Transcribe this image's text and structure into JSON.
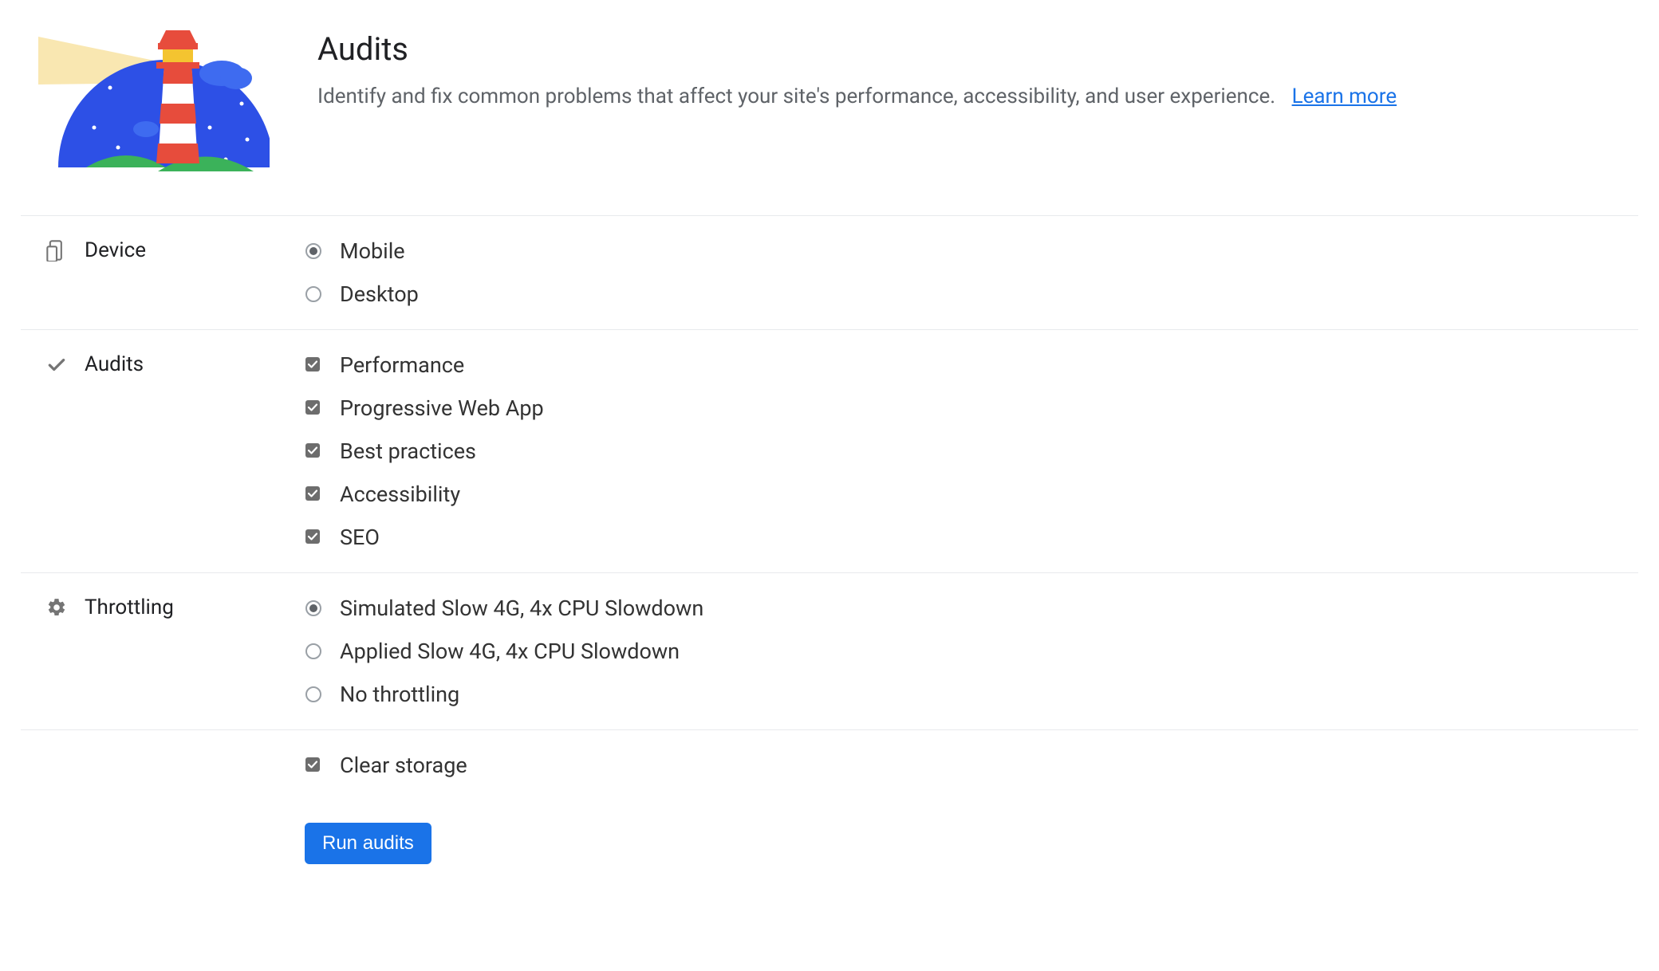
{
  "header": {
    "title": "Audits",
    "subtitle": "Identify and fix common problems that affect your site's performance, accessibility, and user experience.",
    "learn_more": "Learn more"
  },
  "sections": {
    "device": {
      "label": "Device",
      "options": [
        {
          "label": "Mobile",
          "selected": true
        },
        {
          "label": "Desktop",
          "selected": false
        }
      ]
    },
    "audits": {
      "label": "Audits",
      "options": [
        {
          "label": "Performance",
          "checked": true
        },
        {
          "label": "Progressive Web App",
          "checked": true
        },
        {
          "label": "Best practices",
          "checked": true
        },
        {
          "label": "Accessibility",
          "checked": true
        },
        {
          "label": "SEO",
          "checked": true
        }
      ]
    },
    "throttling": {
      "label": "Throttling",
      "options": [
        {
          "label": "Simulated Slow 4G, 4x CPU Slowdown",
          "selected": true
        },
        {
          "label": "Applied Slow 4G, 4x CPU Slowdown",
          "selected": false
        },
        {
          "label": "No throttling",
          "selected": false
        }
      ]
    },
    "storage": {
      "options": [
        {
          "label": "Clear storage",
          "checked": true
        }
      ]
    }
  },
  "actions": {
    "run_button": "Run audits"
  },
  "colors": {
    "link": "#1a73e8",
    "button_bg": "#1a73e8",
    "divider": "#e8eaed",
    "text_secondary": "#5f6368"
  }
}
